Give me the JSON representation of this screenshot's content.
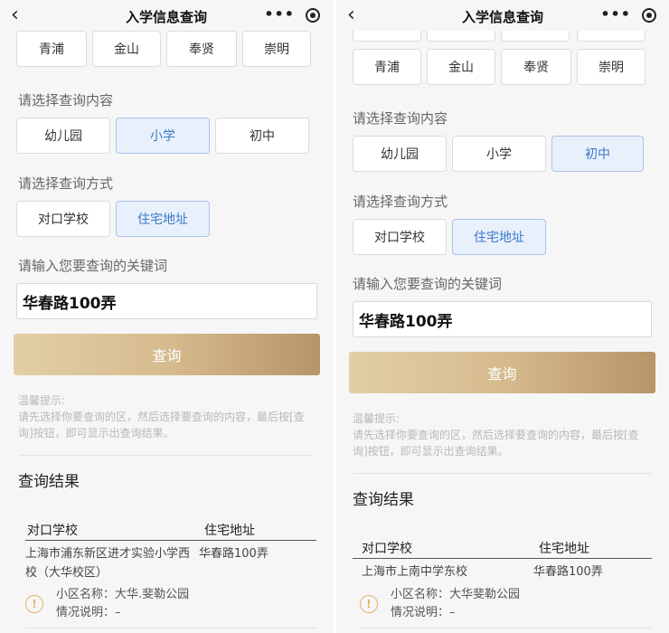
{
  "header": {
    "title": "入学信息查询",
    "back": "‹",
    "more": "•••"
  },
  "left": {
    "districts": [
      "青浦",
      "金山",
      "奉贤",
      "崇明"
    ],
    "content_label": "请选择查询内容",
    "content_options": [
      "幼儿园",
      "小学",
      "初中"
    ],
    "method_label": "请选择查询方式",
    "method_options": [
      "对口学校",
      "住宅地址"
    ],
    "keyword_label": "请输入您要查询的关键词",
    "keyword_value": "华春路100弄",
    "query_button": "查询",
    "hint_title": "温馨提示:",
    "hint_text": "请先选择你要查询的区，然后选择要查询的内容，最后按[查询]按钮，即可显示出查询结果。",
    "result_title": "查询结果",
    "columns": [
      "对口学校",
      "住宅地址"
    ],
    "row": {
      "school_line1": "上海市浦东新区进才实验小学西",
      "school_line2": "校（大华校区）",
      "address": "华春路100弄"
    },
    "community_label": "小区名称：大华.斐勒公园",
    "note_label": "情况说明：–"
  },
  "right": {
    "districts": [
      "青浦",
      "金山",
      "奉贤",
      "崇明"
    ],
    "content_label": "请选择查询内容",
    "content_options": [
      "幼儿园",
      "小学",
      "初中"
    ],
    "method_label": "请选择查询方式",
    "method_options": [
      "对口学校",
      "住宅地址"
    ],
    "keyword_label": "请输入您要查询的关键词",
    "keyword_value": "华春路100弄",
    "query_button": "查询",
    "hint_title": "温馨提示:",
    "hint_text": "请先选择你要查询的区，然后选择要查询的内容，最后按[查询]按钮，即可显示出查询结果。",
    "result_title": "查询结果",
    "columns": [
      "对口学校",
      "住宅地址"
    ],
    "row": {
      "school_line1": "上海市上南中学东校",
      "address": "华春路100弄"
    },
    "community_label": "小区名称：大华斐勒公园",
    "note_label": "情况说明：–"
  }
}
